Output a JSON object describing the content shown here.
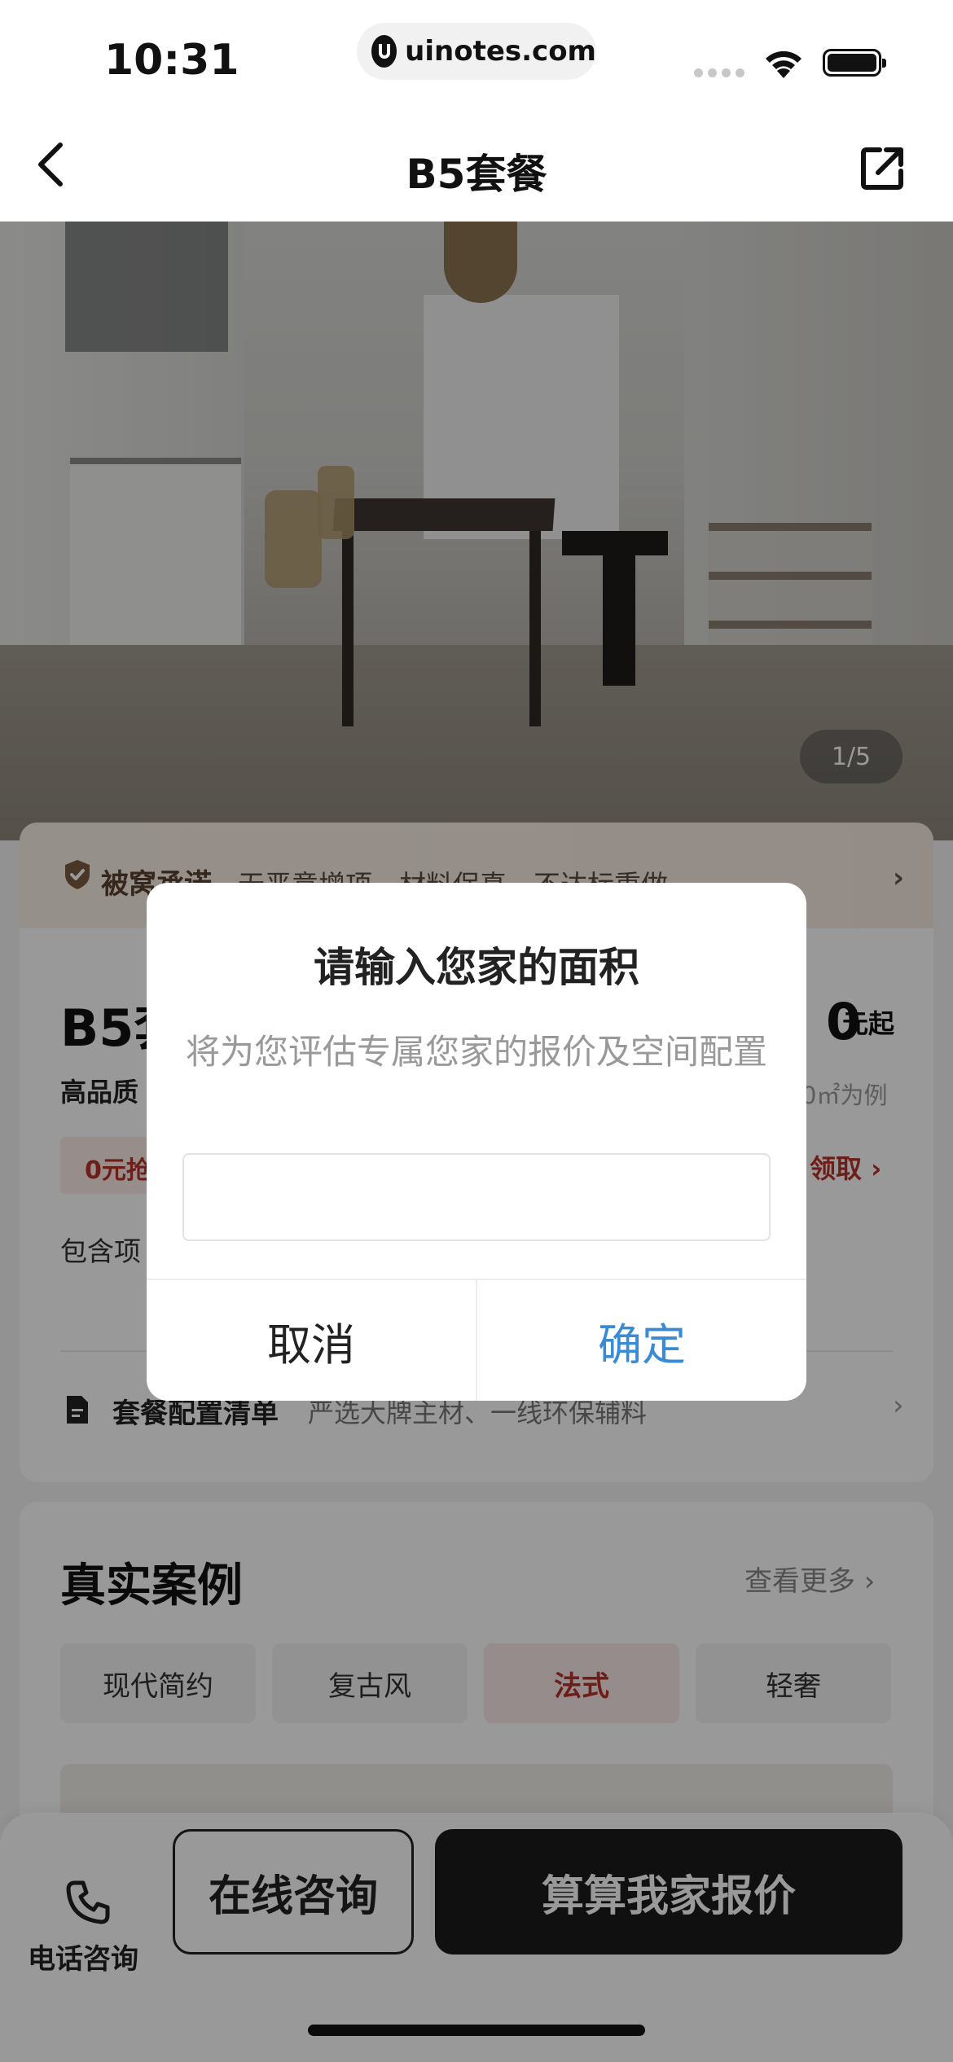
{
  "status_bar": {
    "time": "10:31",
    "url": "uinotes.com"
  },
  "nav": {
    "title": "B5套餐"
  },
  "hero": {
    "page_indicator": "1/5"
  },
  "promise": {
    "label": "被窝承诺",
    "text": "无恶意增项、材料保真、不达标重做"
  },
  "package": {
    "name": "B5套",
    "price": "0",
    "price_unit": "元起",
    "description": "高品质",
    "example": "0㎡为例",
    "offer": "0元抢",
    "claim": "领取",
    "includes": "包含项",
    "list_label": "套餐配置清单",
    "list_text": "严选大牌主材、一线环保辅料"
  },
  "cases": {
    "title": "真实案例",
    "more": "查看更多",
    "tabs": [
      {
        "label": "现代简约",
        "active": false
      },
      {
        "label": "复古风",
        "active": false
      },
      {
        "label": "法式",
        "active": true
      },
      {
        "label": "轻奢",
        "active": false
      }
    ]
  },
  "bottom_bar": {
    "phone_label": "电话咨询",
    "consult_label": "在线咨询",
    "quote_label": "算算我家报价"
  },
  "dialog": {
    "title": "请输入您家的面积",
    "message": "将为您评估专属您家的报价及空间配置",
    "input_value": "",
    "cancel_label": "取消",
    "confirm_label": "确定"
  },
  "colors": {
    "accent_red": "#b6322a",
    "confirm_blue": "#3a8bd6",
    "primary_dark": "#1c1c1c"
  }
}
